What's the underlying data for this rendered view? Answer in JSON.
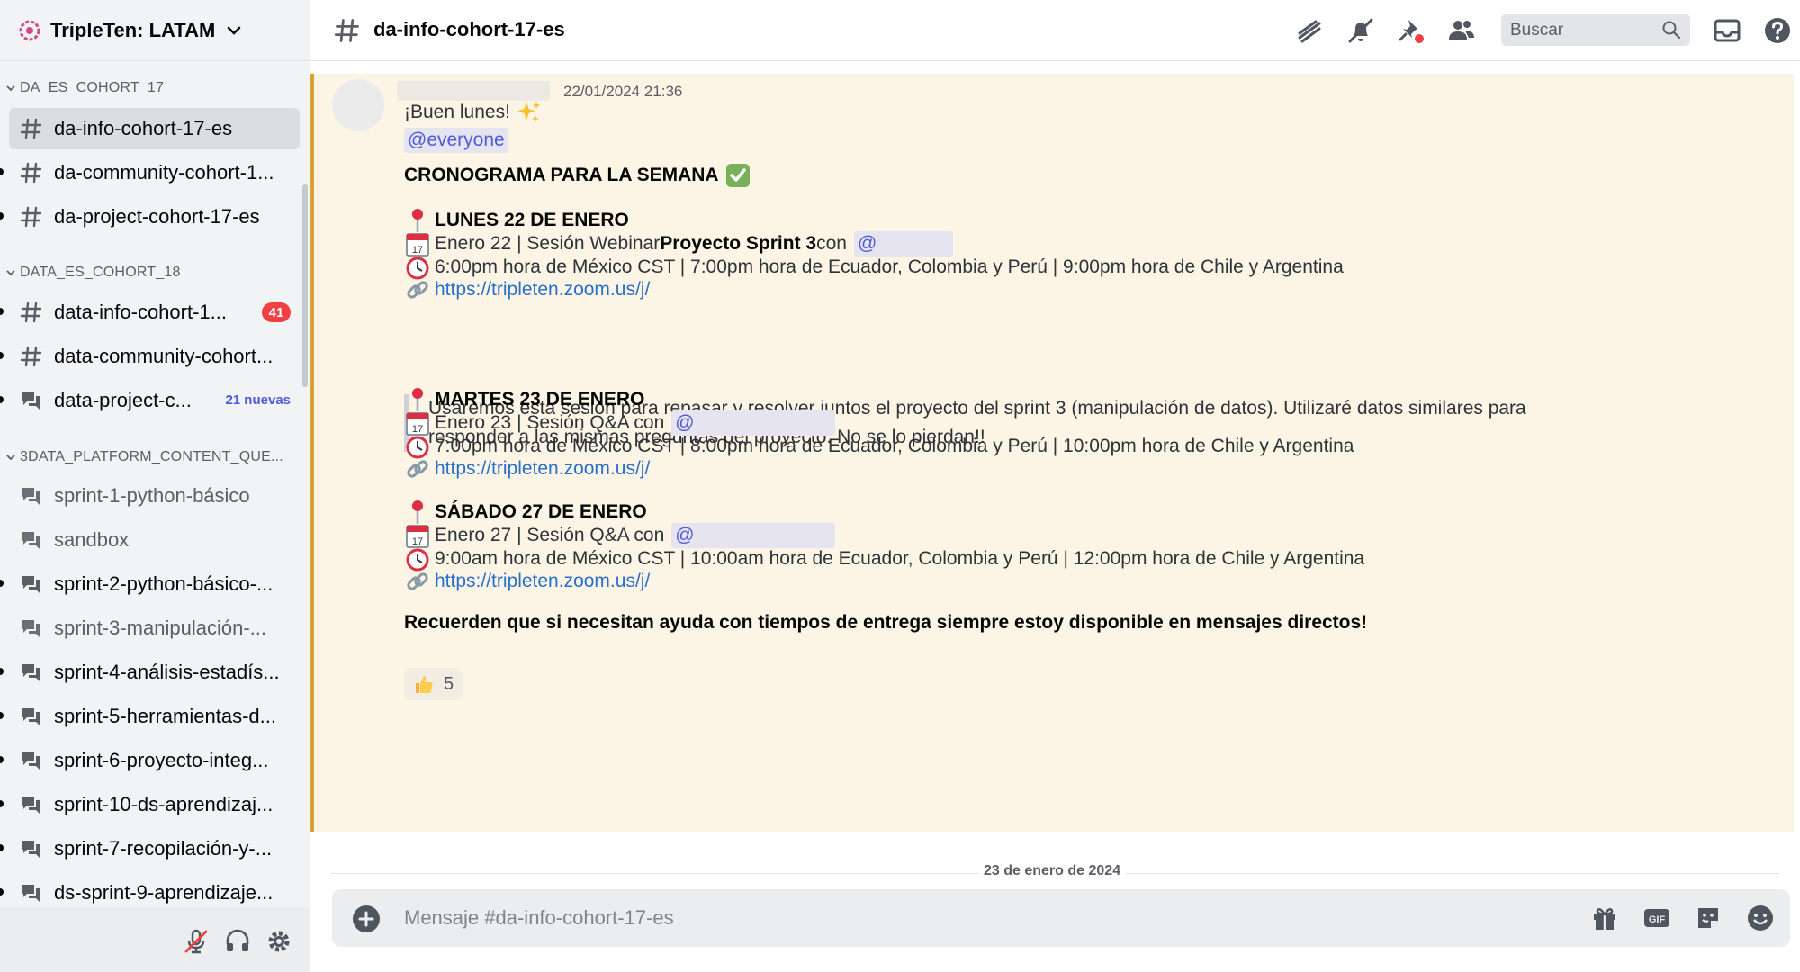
{
  "server": {
    "name": "TripleTen: LATAM"
  },
  "sidebar": {
    "categories": [
      {
        "name": "DA_ES_COHORT_17",
        "channels": [
          {
            "name": "da-info-cohort-17-es",
            "icon": "hash-icon",
            "selected": true
          },
          {
            "name": "da-community-cohort-1...",
            "icon": "hash-icon",
            "unread": true
          },
          {
            "name": "da-project-cohort-17-es",
            "icon": "hash-icon",
            "unread": true
          }
        ]
      },
      {
        "name": "DATA_ES_COHORT_18",
        "channels": [
          {
            "name": "data-info-cohort-1...",
            "icon": "hash-icon",
            "unread": true,
            "badge": "41"
          },
          {
            "name": "data-community-cohort...",
            "icon": "hash-icon",
            "unread": true
          },
          {
            "name": "data-project-c...",
            "icon": "forum-icon",
            "unread": true,
            "new_label": "21 nuevas"
          }
        ]
      },
      {
        "name": "3DATA_PLATFORM_CONTENT_QUE...",
        "channels": [
          {
            "name": "sprint-1-python-básico",
            "icon": "forum-icon",
            "muted": true
          },
          {
            "name": "sandbox",
            "icon": "forum-icon",
            "muted": true
          },
          {
            "name": "sprint-2-python-básico-...",
            "icon": "forum-icon",
            "unread": true
          },
          {
            "name": "sprint-3-manipulación-...",
            "icon": "forum-icon",
            "muted": true
          },
          {
            "name": "sprint-4-análisis-estadís...",
            "icon": "forum-icon",
            "unread": true
          },
          {
            "name": "sprint-5-herramientas-d...",
            "icon": "forum-icon",
            "unread": true
          },
          {
            "name": "sprint-6-proyecto-integ...",
            "icon": "forum-icon",
            "unread": true
          },
          {
            "name": "sprint-10-ds-aprendizaj...",
            "icon": "forum-icon",
            "unread": true
          },
          {
            "name": "sprint-7-recopilación-y-...",
            "icon": "forum-icon",
            "unread": true
          },
          {
            "name": "ds-sprint-9-aprendizaje...",
            "icon": "forum-icon",
            "unread": true
          }
        ]
      }
    ],
    "user_panel": {
      "icons": [
        "mic-muted-icon",
        "headphones-icon",
        "settings-gear-icon"
      ]
    }
  },
  "topbar": {
    "channel": "da-info-cohort-17-es",
    "icons": [
      "threads-icon",
      "notifications-muted-icon",
      "pinned-messages-icon",
      "member-list-icon"
    ],
    "search_placeholder": "Buscar",
    "right_icons": [
      "inbox-icon",
      "help-icon"
    ]
  },
  "message": {
    "timestamp": "22/01/2024 21:36",
    "greeting": "¡Buen lunes!",
    "mention_everyone": "@everyone",
    "title": "CRONOGRAMA PARA LA SEMANA",
    "days": [
      {
        "heading": "LUNES 22 DE ENERO",
        "session_prefix": "Enero 22 | Sesión Webinar ",
        "session_bold": "Proyecto Sprint 3",
        "session_suffix": " con",
        "mention": "@",
        "times": "6:00pm hora de México CST | 7:00pm hora de Ecuador, Colombia y Perú | 9:00pm hora de Chile y Argentina",
        "link": "https://tripleten.zoom.us/j/"
      },
      {
        "heading": "MARTES 23 DE ENERO",
        "session_prefix": "Enero 23 | Sesión Q&A con",
        "mention": "@",
        "times": "7:00pm hora de México CST | 8:00pm hora de Ecuador, Colombia y Perú | 10:00pm hora de Chile y Argentina",
        "link": "https://tripleten.zoom.us/j/"
      },
      {
        "heading": "SÁBADO 27 DE ENERO",
        "session_prefix": "Enero 27 | Sesión Q&A con",
        "mention": "@",
        "times": "9:00am hora de México CST | 10:00am hora de Ecuador, Colombia y Perú | 12:00pm hora de Chile y Argentina",
        "link": "https://tripleten.zoom.us/j/"
      }
    ],
    "quote": "Usaremos esta sesión para repasar y resolver juntos el proyecto del sprint 3 (manipulación de datos). Utilizaré datos similares para responder a las mismas preguntas del proyecto. No se lo pierdan!!",
    "closing": "Recuerden que si necesitan ayuda con tiempos de entrega siempre estoy disponible en mensajes directos!",
    "reaction": {
      "emoji": "thumbs-up-icon",
      "count": "5"
    }
  },
  "date_divider": "23 de enero de 2024",
  "composer": {
    "placeholder": "Mensaje #da-info-cohort-17-es",
    "icons": [
      "gift-icon",
      "gif-icon",
      "sticker-icon",
      "emoji-icon"
    ]
  },
  "colors": {
    "sidebar_bg": "#f2f3f5",
    "highlight_bg": "#fcf5e6",
    "highlight_border": "#d7a235",
    "mention_fg": "#4e5bd9",
    "link": "#2a6fc9",
    "badge_red": "#f23f43"
  }
}
